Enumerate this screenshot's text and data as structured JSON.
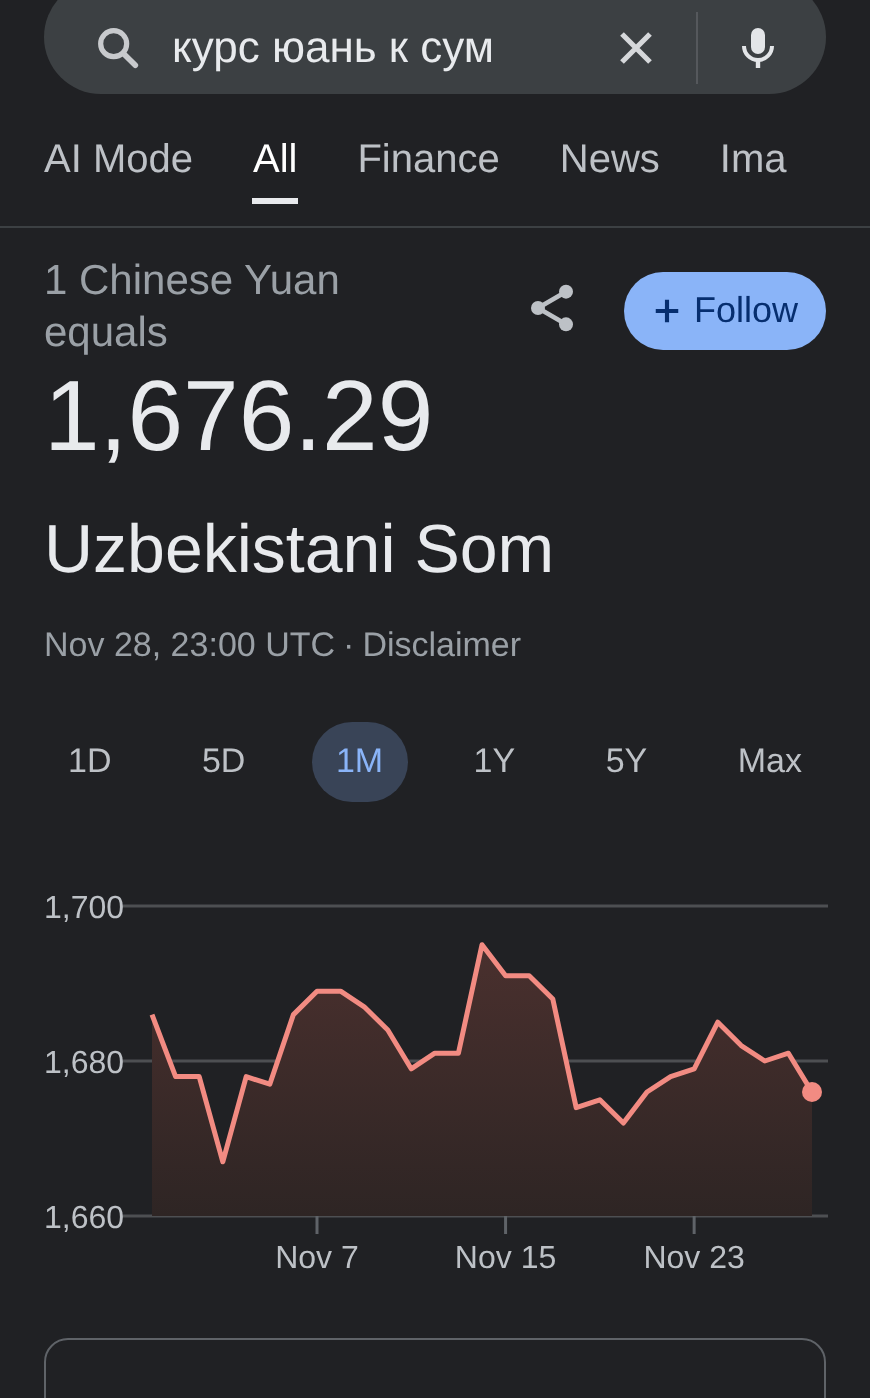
{
  "search": {
    "value": "курс юань к сум"
  },
  "tabs": [
    {
      "label": "AI Mode",
      "selected": false
    },
    {
      "label": "All",
      "selected": true
    },
    {
      "label": "Finance",
      "selected": false
    },
    {
      "label": "News",
      "selected": false
    },
    {
      "label": "Ima",
      "selected": false
    }
  ],
  "converter": {
    "source": "1 Chinese Yuan equals",
    "amount": "1,676.29",
    "target": "Uzbekistani Som",
    "timestamp": "Nov 28, 23:00 UTC",
    "separator": "·",
    "disclaimer": "Disclaimer",
    "follow": "Follow"
  },
  "ranges": [
    {
      "label": "1D",
      "selected": false
    },
    {
      "label": "5D",
      "selected": false
    },
    {
      "label": "1M",
      "selected": true
    },
    {
      "label": "1Y",
      "selected": false
    },
    {
      "label": "5Y",
      "selected": false
    },
    {
      "label": "Max",
      "selected": false
    }
  ],
  "chart_data": {
    "type": "area",
    "categories": [
      null,
      null,
      null,
      null,
      null,
      null,
      null,
      "Nov 7",
      null,
      null,
      null,
      null,
      null,
      null,
      null,
      "Nov 15",
      null,
      null,
      null,
      null,
      null,
      null,
      null,
      "Nov 23",
      null,
      null,
      null,
      null,
      null
    ],
    "series": [
      {
        "color": "#f28b82",
        "values": [
          1686,
          1678,
          1678,
          1667,
          1678,
          1677,
          1686,
          1689,
          1689,
          1687,
          1684,
          1679,
          1681,
          1681,
          1695,
          1691,
          1691,
          1688,
          1674,
          1675,
          1672,
          1676,
          1678,
          1679,
          1685,
          1682,
          1680,
          1681,
          1676
        ]
      }
    ],
    "ylim": [
      1660,
      1700
    ],
    "yticks": [
      {
        "value": 1660,
        "label": "1,660"
      },
      {
        "value": 1680,
        "label": "1,680"
      },
      {
        "value": 1700,
        "label": "1,700"
      }
    ]
  }
}
